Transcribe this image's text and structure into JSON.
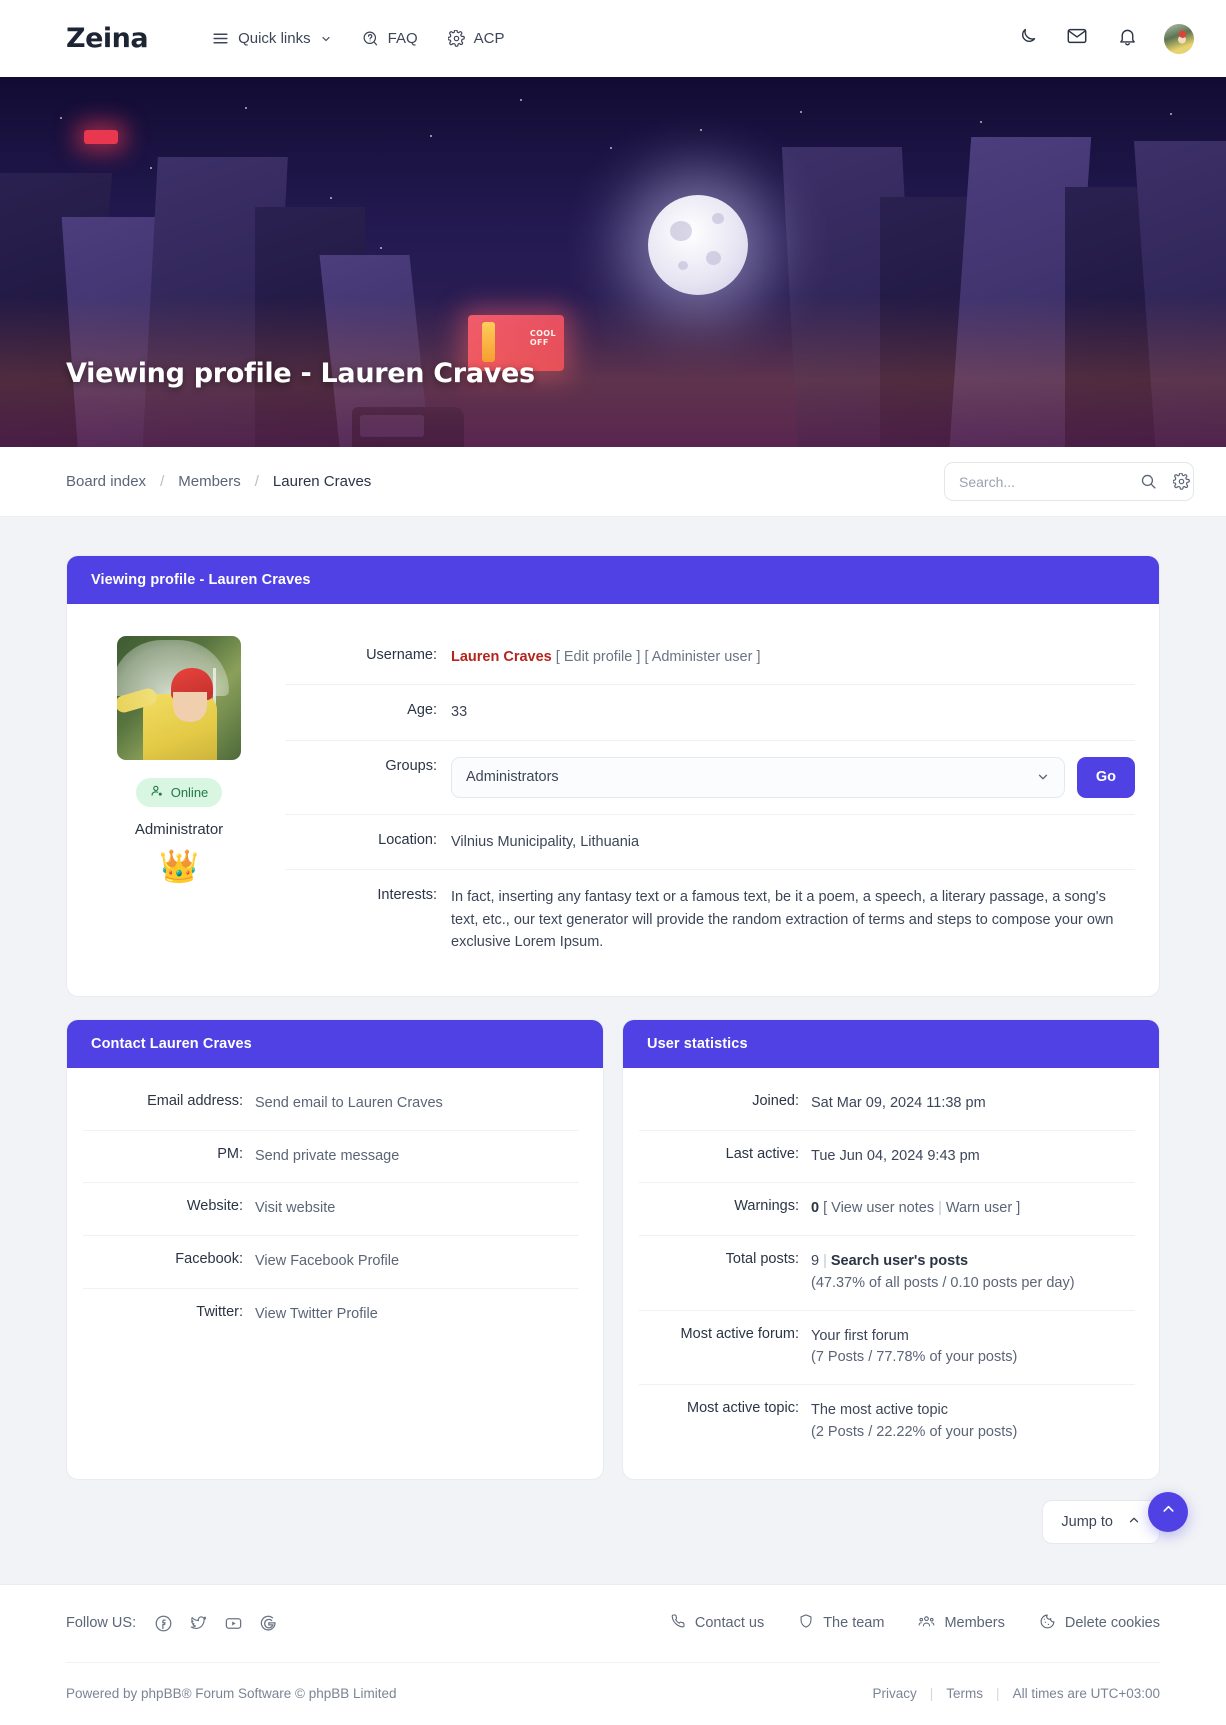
{
  "header": {
    "brand": "Zeina",
    "nav": [
      {
        "label": "Quick links",
        "icon": "hamburger-icon",
        "caret": true
      },
      {
        "label": "FAQ",
        "icon": "question-bubble-icon",
        "caret": false
      },
      {
        "label": "ACP",
        "icon": "gear-icon",
        "caret": false
      }
    ],
    "actions": [
      {
        "name": "dark-mode-toggle",
        "icon": "moon-icon"
      },
      {
        "name": "messages-button",
        "icon": "envelope-icon"
      },
      {
        "name": "notifications-button",
        "icon": "bell-icon"
      },
      {
        "name": "user-avatar",
        "icon": "avatar"
      }
    ]
  },
  "hero": {
    "title": "Viewing profile - Lauren Craves",
    "billboard_text": "COOL\nOFF"
  },
  "breadcrumb": {
    "items": [
      "Board index",
      "Members",
      "Lauren Craves"
    ],
    "separator": "/"
  },
  "search": {
    "placeholder": "Search...",
    "value": ""
  },
  "profile": {
    "panel_title": "Viewing profile - Lauren Craves",
    "online_label": "Online",
    "rank": "Administrator",
    "rank_icon": "👑",
    "fields": {
      "username_label": "Username:",
      "username_value": "Lauren Craves",
      "username_edit": "[ Edit profile ]",
      "username_admin": "[ Administer user ]",
      "age_label": "Age:",
      "age_value": "33",
      "groups_label": "Groups:",
      "groups_selected": "Administrators",
      "groups_go": "Go",
      "location_label": "Location:",
      "location_value": "Vilnius Municipality, Lithuania",
      "interests_label": "Interests:",
      "interests_value": "In fact, inserting any fantasy text or a famous text, be it a poem, a speech, a literary passage, a song's text, etc., our text generator will provide the random extraction of terms and steps to compose your own exclusive Lorem Ipsum."
    }
  },
  "contact": {
    "panel_title": "Contact Lauren Craves",
    "rows": [
      {
        "label": "Email address:",
        "value": "Send email to Lauren Craves"
      },
      {
        "label": "PM:",
        "value": "Send private message"
      },
      {
        "label": "Website:",
        "value": "Visit website"
      },
      {
        "label": "Facebook:",
        "value": "View Facebook Profile"
      },
      {
        "label": "Twitter:",
        "value": "View Twitter Profile"
      }
    ]
  },
  "stats": {
    "panel_title": "User statistics",
    "joined_label": "Joined:",
    "joined_value": "Sat Mar 09, 2024 11:38 pm",
    "last_active_label": "Last active:",
    "last_active_value": "Tue Jun 04, 2024 9:43 pm",
    "warnings_label": "Warnings:",
    "warnings_count": "0",
    "warnings_notes": "[ View user notes",
    "warnings_warn": "Warn user ]",
    "total_posts_label": "Total posts:",
    "total_posts_count": "9",
    "total_posts_link": "Search user's posts",
    "total_posts_sub": "(47.37% of all posts / 0.10 posts per day)",
    "most_forum_label": "Most active forum:",
    "most_forum_value": "Your first forum",
    "most_forum_sub": "(7 Posts / 77.78% of your posts)",
    "most_topic_label": "Most active topic:",
    "most_topic_value": "The most active topic",
    "most_topic_sub": "(2 Posts / 22.22% of your posts)"
  },
  "jump_to": {
    "label": "Jump to",
    "icon": "chevron-up-icon"
  },
  "footer": {
    "follow_label": "Follow US:",
    "social": [
      "facebook-icon",
      "twitter-icon",
      "youtube-icon",
      "google-icon"
    ],
    "links": [
      {
        "label": "Contact us",
        "icon": "phone-icon"
      },
      {
        "label": "The team",
        "icon": "shield-icon"
      },
      {
        "label": "Members",
        "icon": "people-icon"
      },
      {
        "label": "Delete cookies",
        "icon": "cookie-icon"
      }
    ],
    "copyright": "Powered by phpBB® Forum Software © phpBB Limited",
    "privacy": "Privacy",
    "terms": "Terms",
    "timezone": "All times are UTC+03:00",
    "sep": "|"
  },
  "colors": {
    "accent": "#4f41e4",
    "username": "#b3261e",
    "online_bg": "#d8f6e1",
    "online_fg": "#1f7a46"
  }
}
